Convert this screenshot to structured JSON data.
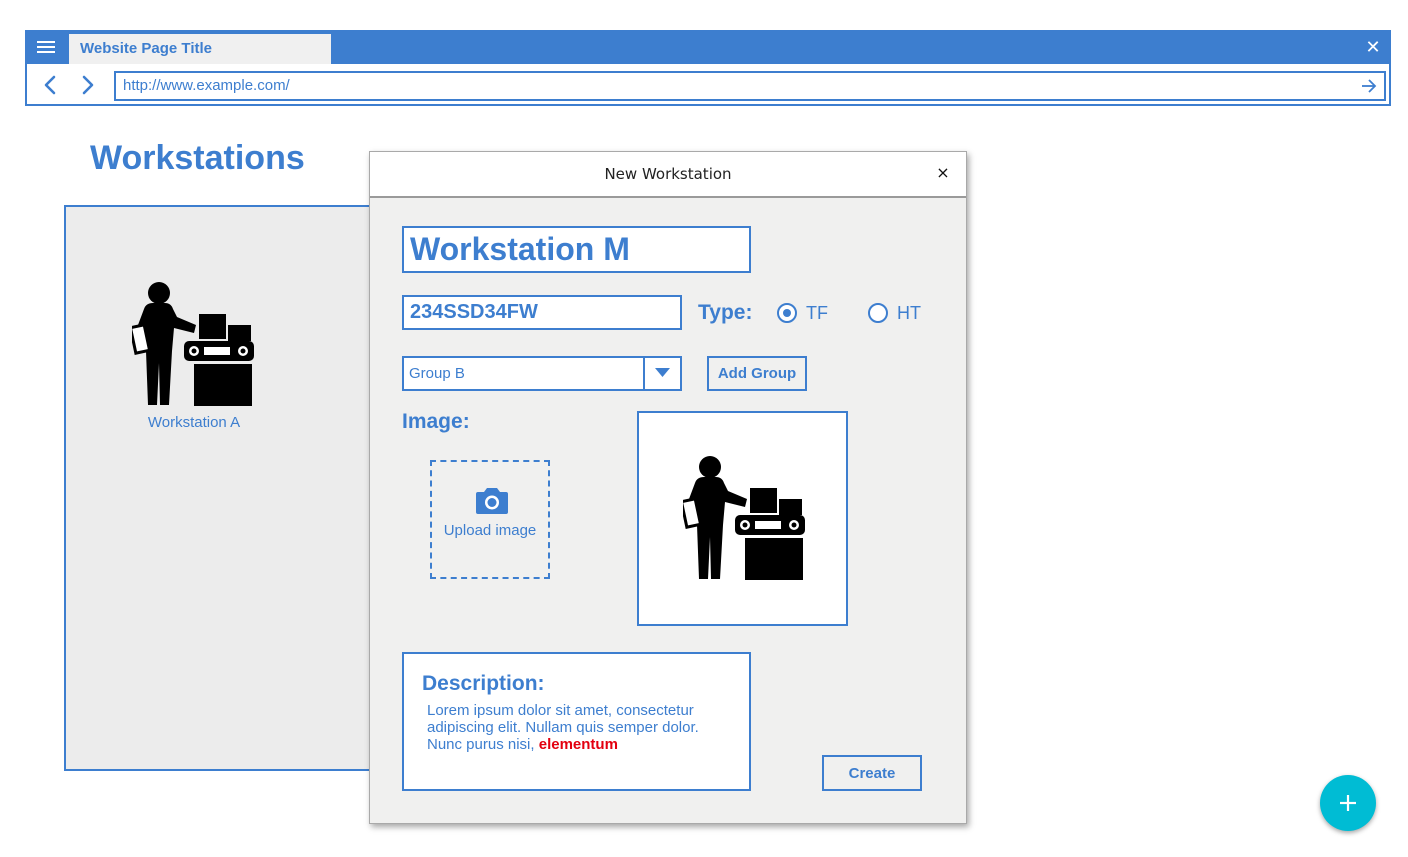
{
  "browser": {
    "tab_title": "Website Page Title",
    "url": "http://www.example.com/",
    "close_symbol": "✕",
    "icons": [
      "menu-icon",
      "close-icon",
      "back-arrow-icon",
      "forward-arrow-icon",
      "go-arrow-icon"
    ]
  },
  "page": {
    "title": "Workstations",
    "cards": [
      {
        "label": "Workstation A",
        "icon": "worker-machine-icon"
      }
    ]
  },
  "dialog": {
    "title": "New Workstation",
    "close_symbol": "×",
    "name_value": "Workstation M",
    "serial_value": "234SSD34FW",
    "type_label": "Type:",
    "type_options": [
      {
        "label": "TF",
        "selected": true
      },
      {
        "label": "HT",
        "selected": false
      }
    ],
    "group_value": "Group B",
    "add_group_label": "Add Group",
    "image_label": "Image:",
    "upload_label": "Upload image",
    "description": {
      "title": "Description:",
      "text": "Lorem ipsum dolor sit amet, consectetur adipiscing elit. Nullam quis semper dolor. Nunc purus nisi,",
      "highlight": "elementum",
      "highlight_color": "#e3000f"
    },
    "create_label": "Create"
  },
  "fab": {
    "icon": "plus-icon",
    "color": "#00bcd4"
  },
  "colors": {
    "accent": "#3d7ecf",
    "panel_bg": "#ececec",
    "dialog_bg": "#f0f0ef"
  }
}
